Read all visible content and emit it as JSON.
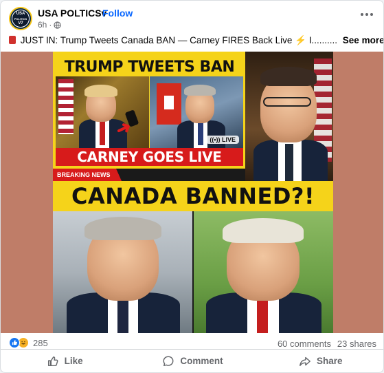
{
  "post": {
    "page_name": "USA POLTICSv",
    "separator": "·",
    "follow_label": "Follow",
    "time": "6h",
    "meta_dot": "·",
    "avatar_text_1": "USA",
    "avatar_text_2": "POLITICS",
    "avatar_text_3": "V7",
    "caption": "JUST IN: Trump Tweets Canada BAN — Carney FIRES Back Live",
    "caption_tail": " I..........",
    "see_more": "See more"
  },
  "media": {
    "headline_top": "TRUMP TWEETS BAN",
    "headline_live": "CARNEY GOES LIVE",
    "live_badge": "LIVE",
    "breaking_label": "BREAKING NEWS",
    "headline_main": "CANADA BANNED?!"
  },
  "stats": {
    "reaction_count": "285",
    "comments": "60 comments",
    "shares": "23 shares"
  },
  "actions": {
    "like": "Like",
    "comment": "Comment",
    "share": "Share"
  },
  "colors": {
    "accent": "#0866ff",
    "banner_yellow": "#f5d31a",
    "banner_red": "#d71b1b",
    "media_background": "#bf7d68"
  },
  "icons": [
    "globe-icon",
    "more-icon",
    "like-reaction-icon",
    "haha-reaction-icon",
    "like-icon",
    "comment-icon",
    "share-icon"
  ]
}
